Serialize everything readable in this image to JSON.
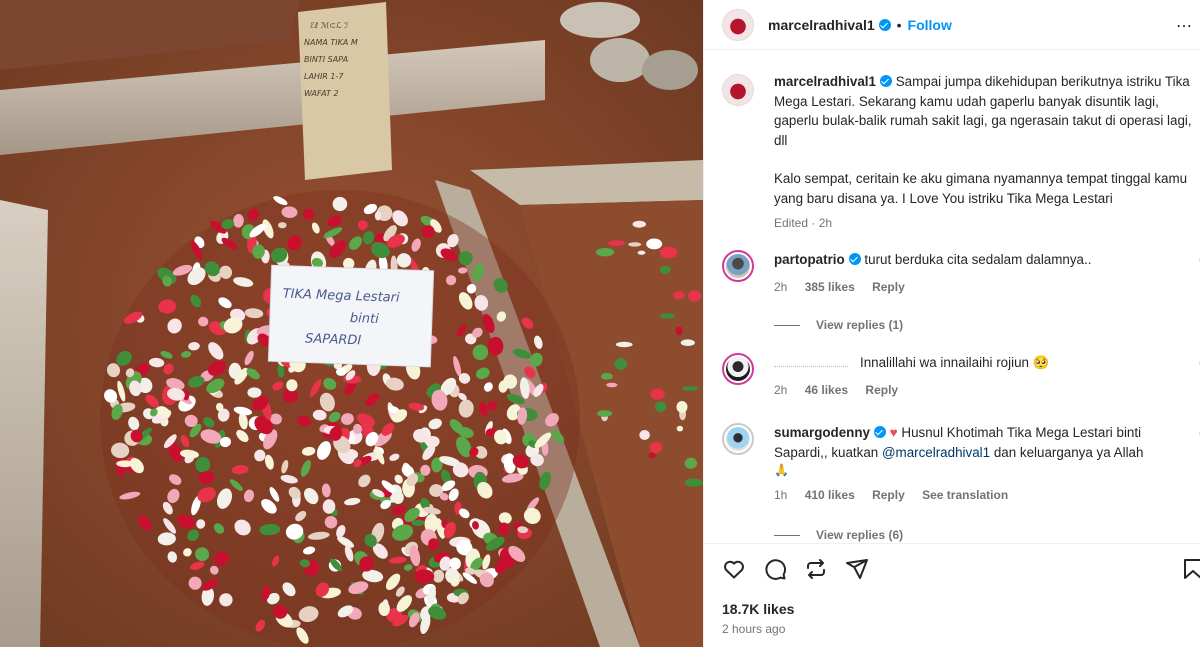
{
  "post": {
    "username": "marcelradhival1",
    "follow_label": "Follow",
    "separator": "•",
    "caption_paragraphs": [
      "Sampai jumpa dikehidupan berikutnya istriku Tika Mega Lestari. Sekarang kamu udah gaperlu banyak disuntik lagi, gaperlu bulak-balik rumah sakit lagi, ga ngerasain takut di operasi lagi, dll",
      "Kalo sempat, ceritain ke aku gimana nyamannya tempat tinggal kamu yang baru disana ya. I Love You istriku Tika Mega Lestari"
    ],
    "caption_meta": "Edited · 2h",
    "likes": "18.7K likes",
    "time_ago": "2 hours ago"
  },
  "photo": {
    "sign_lines": [
      "TIKA Mega Lestari",
      "binti",
      "SAPARDI"
    ]
  },
  "comments": [
    {
      "username": "partopatrio",
      "text": "turut berduka cita sedalam dalamnya..",
      "time": "2h",
      "likes": "385 likes",
      "reply_label": "Reply",
      "view_replies": "View replies (1)"
    },
    {
      "username": "",
      "text": "Innalillahi wa innailaihi rojiun 🥺",
      "time": "2h",
      "likes": "46 likes",
      "reply_label": "Reply"
    },
    {
      "username": "sumargodenny",
      "heart": "♥",
      "text_before": "Husnul Khotimah Tika Mega Lestari binti Sapardi,, kuatkan",
      "mention": "@marcelradhival1",
      "text_after": "dan keluarganya ya Allah",
      "emoji": "🙏",
      "time": "1h",
      "likes": "410 likes",
      "reply_label": "Reply",
      "translation_label": "See translation",
      "view_replies": "View replies (6)"
    }
  ],
  "icons": [
    "heart-icon",
    "comment-icon",
    "repost-icon",
    "share-icon",
    "bookmark-icon",
    "more-icon"
  ],
  "colors": {
    "accent": "#0095f6",
    "text": "#262626",
    "muted": "#737373",
    "story_ring": "#d3379a",
    "soil": "#8a4a2c"
  }
}
